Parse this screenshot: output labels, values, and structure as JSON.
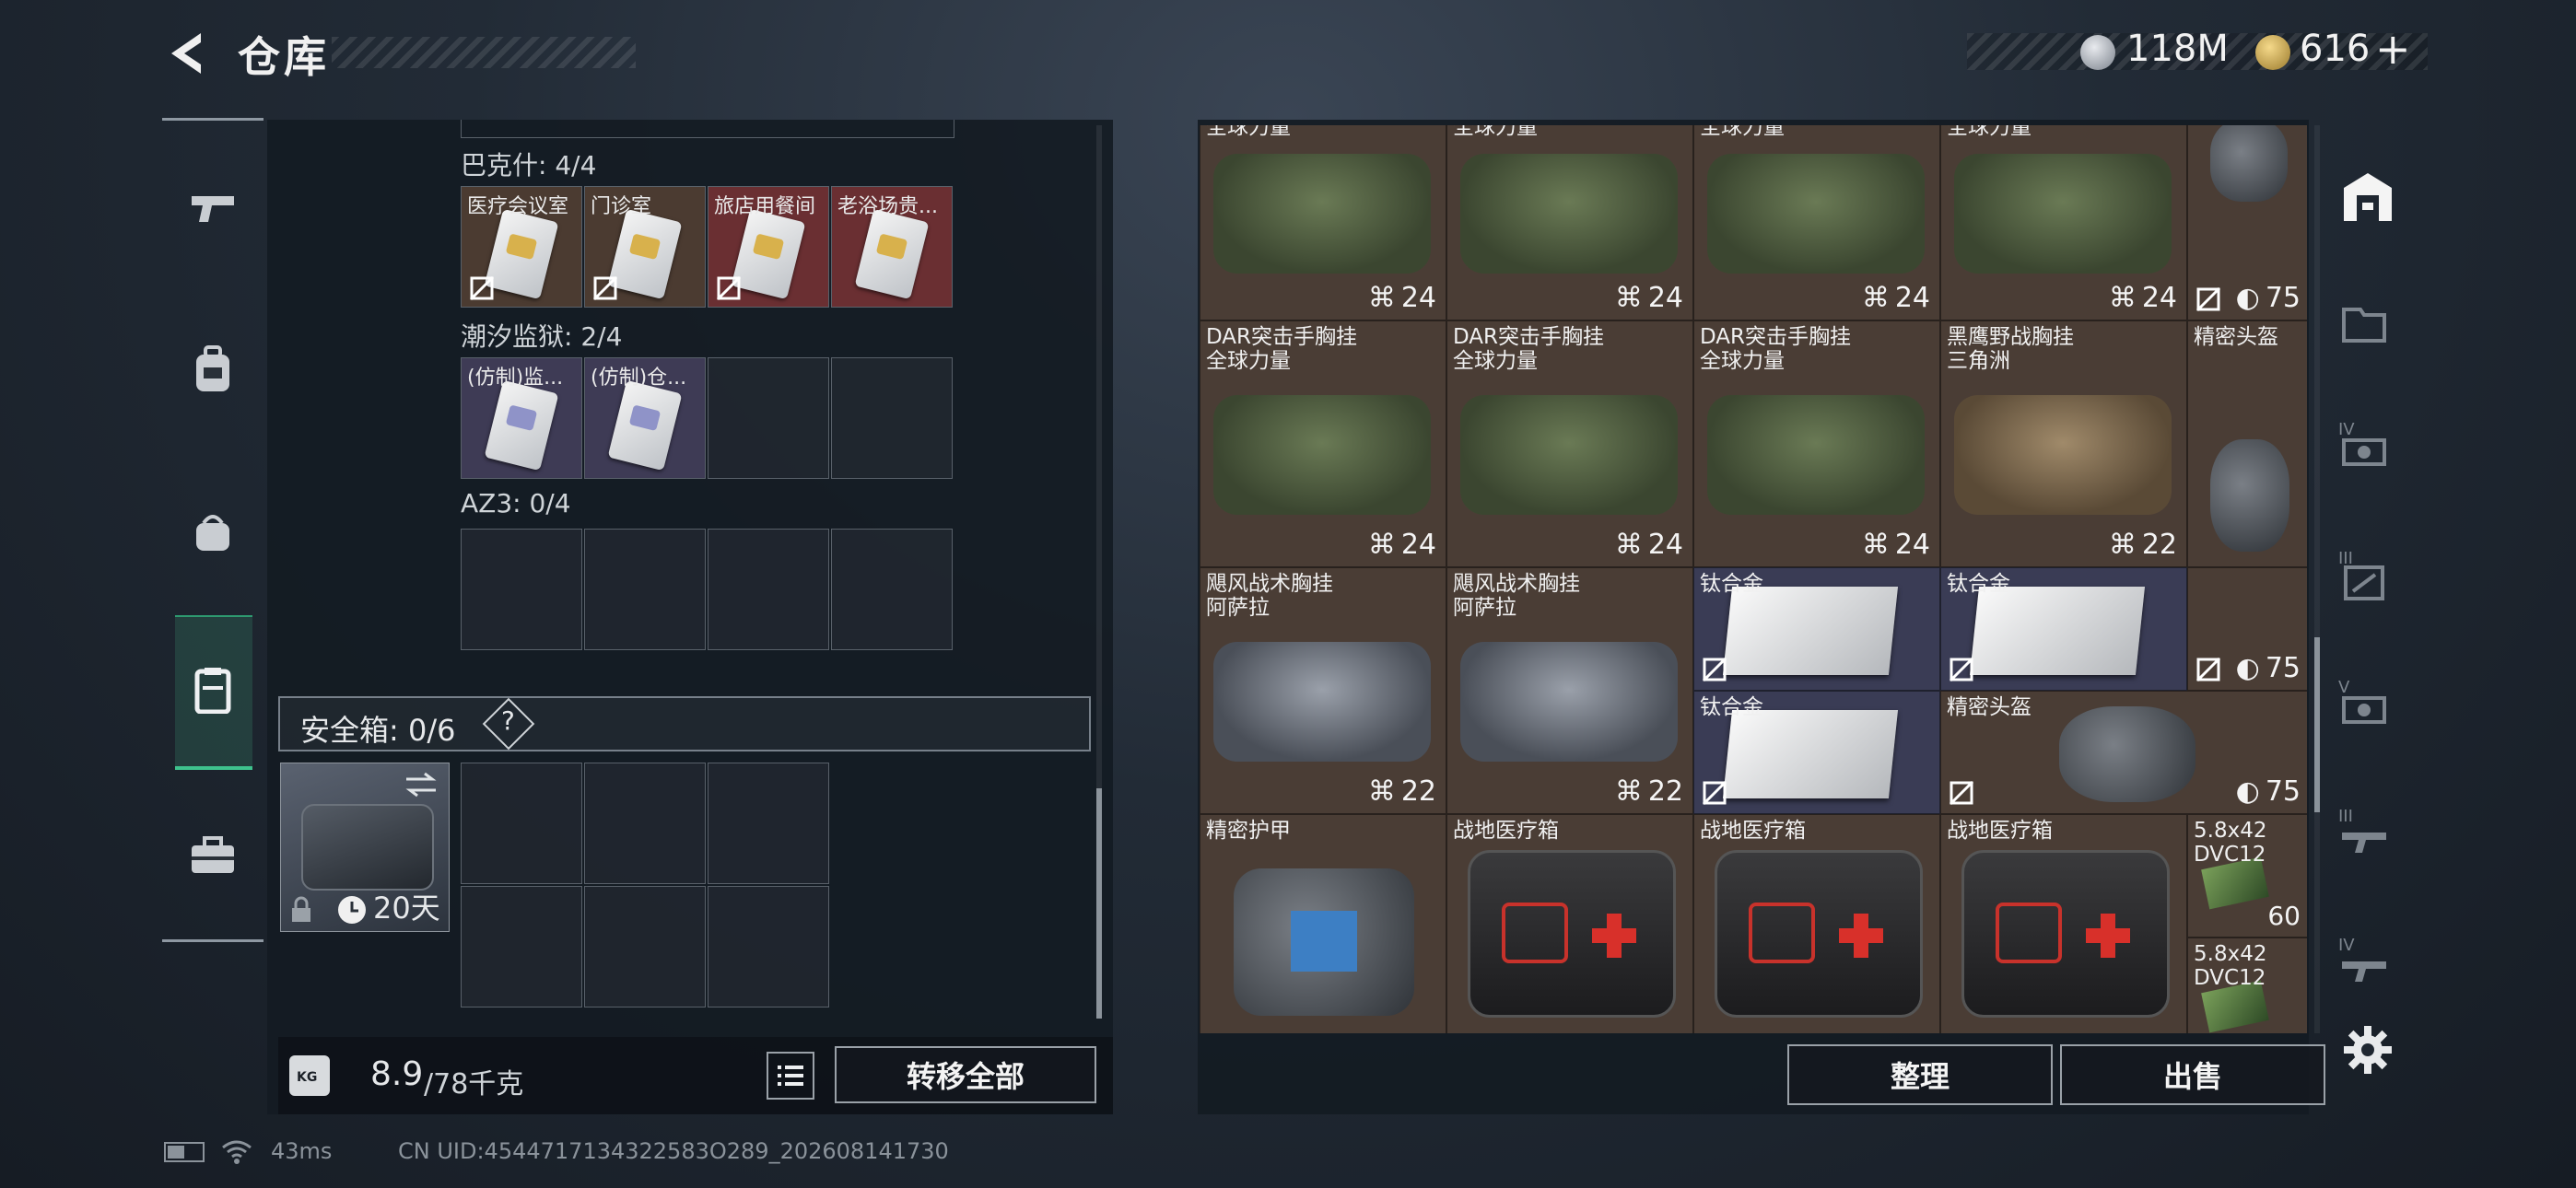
{
  "header": {
    "title": "仓库"
  },
  "currency": {
    "silver": "118M",
    "gold": "616",
    "plus": "+"
  },
  "left_nav": {
    "items": [
      {
        "icon": "pistol-icon"
      },
      {
        "icon": "backpack-icon"
      },
      {
        "icon": "bag-icon"
      },
      {
        "icon": "clipboard-icon",
        "active": true
      },
      {
        "icon": "toolbox-icon"
      }
    ]
  },
  "keycard_sections": [
    {
      "label": "巴克什: 4/4",
      "slots": [
        "医疗会议室",
        "门诊室",
        "旅店用餐间",
        "老浴场贵..."
      ],
      "highlight": [
        2,
        3
      ]
    },
    {
      "label": "潮汐监狱: 2/4",
      "slots": [
        "(仿制)监...",
        "(仿制)仓...",
        "",
        ""
      ]
    },
    {
      "label": "AZ3: 0/4",
      "slots": [
        "",
        "",
        "",
        ""
      ]
    }
  ],
  "safe": {
    "label": "安全箱: 0/6",
    "help": "?",
    "days": "20天"
  },
  "weight": {
    "current": "8.9",
    "max": "/78千克",
    "unit_icon": "KG"
  },
  "buttons": {
    "transfer_all": "转移全部",
    "organize": "整理",
    "sell": "出售"
  },
  "grid": {
    "row0": {
      "name": "全球力量",
      "stat": "24",
      "durability": "75"
    },
    "row1": [
      {
        "name": "DAR突击手胸挂\n全球力量",
        "stat": "24"
      },
      {
        "name": "DAR突击手胸挂\n全球力量",
        "stat": "24"
      },
      {
        "name": "DAR突击手胸挂\n全球力量",
        "stat": "24"
      },
      {
        "name": "黑鹰野战胸挂\n三角洲",
        "stat": "22"
      },
      {
        "name": "精密头盔",
        "stat": ""
      }
    ],
    "row2": [
      {
        "name": "飓风战术胸挂\n阿萨拉",
        "stat": "22"
      },
      {
        "name": "飓风战术胸挂\n阿萨拉",
        "stat": "22"
      },
      {
        "name": "钛合金"
      },
      {
        "name": "钛合金"
      },
      {
        "durability": "75"
      }
    ],
    "row2b": [
      {
        "name": "钛合金"
      },
      {
        "name": "精密头盔",
        "durability": "75"
      }
    ],
    "row3": [
      {
        "name": "精密护甲"
      },
      {
        "name": "战地医疗箱"
      },
      {
        "name": "战地医疗箱"
      },
      {
        "name": "战地医疗箱"
      },
      {
        "name": "5.8x42\nDVC12",
        "count": "60"
      },
      {
        "name": "5.8x42\nDVC12"
      }
    ]
  },
  "right_nav": {
    "tiers": [
      "IV",
      "III",
      "V",
      "III",
      "IV"
    ]
  },
  "status": {
    "ping": "43ms",
    "uid": "CN UID:4544717134322583O289_202608141730"
  }
}
